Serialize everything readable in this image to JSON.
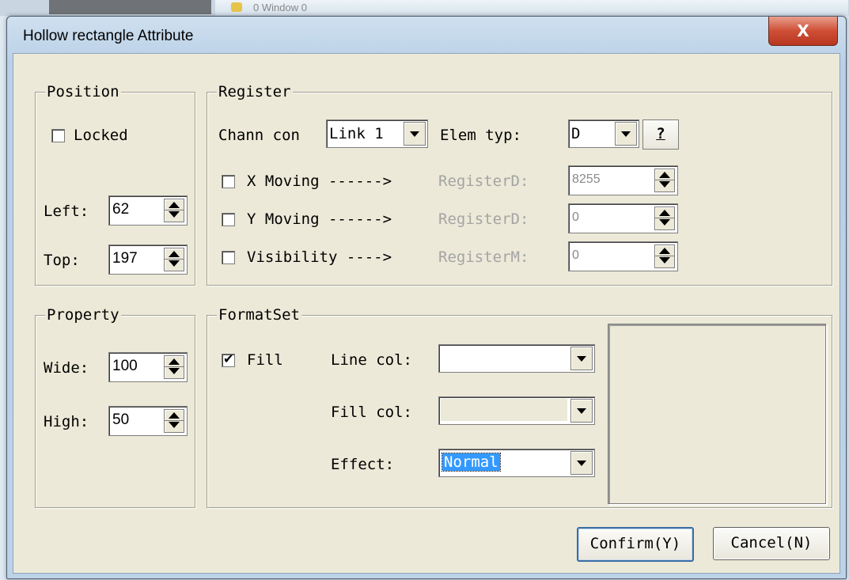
{
  "window": {
    "title": "Hollow rectangle Attribute",
    "close": "X"
  },
  "background": {
    "window_title": "0 Window 0"
  },
  "position": {
    "title": "Position",
    "locked_label": "Locked",
    "locked": false,
    "left_label": "Left:",
    "left_value": "62",
    "top_label": "Top:",
    "top_value": "197"
  },
  "register": {
    "title": "Register",
    "chann_label": "Chann con",
    "chann_value": "Link 1",
    "elem_label": "Elem typ:",
    "elem_value": "D",
    "help_label": "?",
    "x_moving": {
      "label": "X Moving ------>",
      "reg_label": "RegisterD:",
      "value": "8255",
      "checked": false
    },
    "y_moving": {
      "label": "Y Moving ------>",
      "reg_label": "RegisterD:",
      "value": "0",
      "checked": false
    },
    "visibility": {
      "label": "Visibility ---->",
      "reg_label": "RegisterM:",
      "value": "0",
      "checked": false
    }
  },
  "property": {
    "title": "Property",
    "wide_label": "Wide:",
    "wide_value": "100",
    "high_label": "High:",
    "high_value": "50"
  },
  "format": {
    "title": "FormatSet",
    "fill_label": "Fill",
    "fill_checked": true,
    "line_col_label": "Line col:",
    "line_col_color": "#ffffff",
    "fill_col_label": "Fill col:",
    "fill_col_color": "#ece9d8",
    "effect_label": "Effect:",
    "effect_value": "Normal",
    "preview_color": "#ece9d8"
  },
  "buttons": {
    "confirm": "Confirm(Y)",
    "cancel": "Cancel(N)"
  }
}
